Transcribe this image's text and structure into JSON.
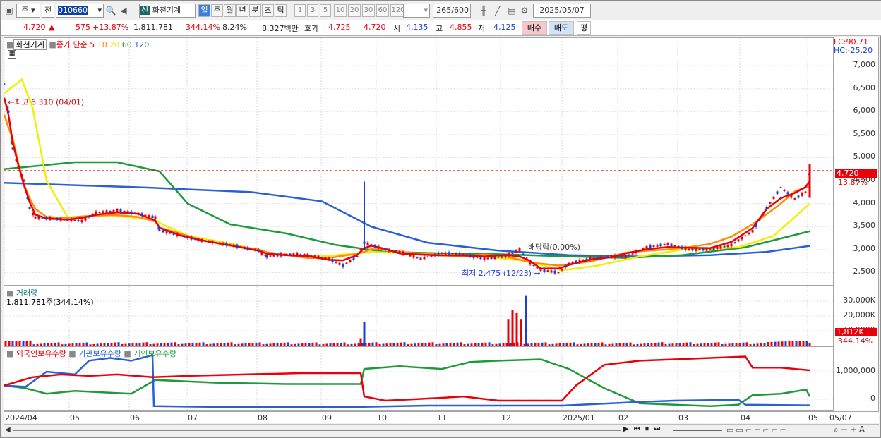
{
  "toolbar": {
    "market": "주",
    "type": "전",
    "code": "010660",
    "name_badge": "신",
    "name": "화천기계",
    "periods": [
      "일",
      "주",
      "월",
      "년",
      "분",
      "초",
      "틱"
    ],
    "minutes": [
      "1",
      "3",
      "5",
      "10",
      "20",
      "30",
      "60",
      "120"
    ],
    "count": "265",
    "count_max": "/600",
    "date": "2025/05/07"
  },
  "quote": {
    "price": "4,720",
    "arrow": "▲",
    "change": "575",
    "pct": "+13.87%",
    "volume": "1,811,781",
    "vol_ratio": "344.14%",
    "turnover": "8.24%",
    "amount": "8,327백만",
    "bid_label": "호가",
    "ask": "4,725",
    "bid": "4,720",
    "open_label": "시",
    "open": "4,135",
    "high_label": "고",
    "high": "4,855",
    "low_label": "저",
    "low": "4,125",
    "buy": "매수",
    "sell": "매도",
    "avg": "평"
  },
  "price_pane": {
    "name": "화천기계",
    "ma_title": "종가 단순",
    "ma_periods": [
      "5",
      "10",
      "20",
      "60",
      "120"
    ],
    "ma_colors": [
      "#e8000b",
      "#ff8c00",
      "#f0f000",
      "#1e9a3c",
      "#2a5fd6"
    ],
    "lc": "LC:90.71",
    "hc": "HC:-25.20",
    "last": "4,720",
    "last_pct": "13.87%",
    "high_note": "←최고 6,310 (04/01)",
    "low_note": "최저 2,475 (12/23) →",
    "div_note": "배당락(0.00%)",
    "ticks": [
      "7,000",
      "6,500",
      "6,000",
      "5,500",
      "5,000",
      "4,500",
      "4,000",
      "3,500",
      "3,000",
      "2,500"
    ]
  },
  "volume_pane": {
    "title": "거래량",
    "value": "1,811,781주(344.14%)",
    "ticks": [
      "30,000K",
      "20,000K",
      "10,000K"
    ],
    "last": "1,812K",
    "last_pct": "344.14%"
  },
  "holders_pane": {
    "titles": [
      "외국인보유수량",
      "기관보유수량",
      "개인보유수량"
    ],
    "colors": [
      "#e8000b",
      "#2a5fd6",
      "#1e9a3c"
    ],
    "ticks": [
      "1,000,000",
      "0"
    ]
  },
  "xaxis": {
    "labels": [
      "2024/04",
      "05",
      "06",
      "07",
      "08",
      "09",
      "10",
      "11",
      "12",
      "2025/01",
      "02",
      "03",
      "04",
      "05",
      "05/07"
    ]
  },
  "chart_data": {
    "type": "line",
    "title": "화천기계",
    "x_range": [
      "2024/04",
      "2025/05/07"
    ],
    "price_approx": [
      {
        "x": "2024/04/01",
        "y": 6310
      },
      {
        "x": "2024/04/20",
        "y": 3700
      },
      {
        "x": "2024/05",
        "y": 3650
      },
      {
        "x": "2024/06",
        "y": 3800
      },
      {
        "x": "2024/07",
        "y": 3250
      },
      {
        "x": "2024/08",
        "y": 2900
      },
      {
        "x": "2024/09",
        "y": 2700
      },
      {
        "x": "2024/10",
        "y": 3000
      },
      {
        "x": "2024/11",
        "y": 2900
      },
      {
        "x": "2024/12",
        "y": 2800
      },
      {
        "x": "2024/12/23",
        "y": 2475
      },
      {
        "x": "2025/01",
        "y": 2800
      },
      {
        "x": "2025/02",
        "y": 2850
      },
      {
        "x": "2025/03",
        "y": 3100
      },
      {
        "x": "2025/04",
        "y": 3100
      },
      {
        "x": "2025/04/20",
        "y": 4300
      },
      {
        "x": "2025/05/07",
        "y": 4720
      }
    ],
    "ylim": [
      2200,
      7600
    ]
  }
}
